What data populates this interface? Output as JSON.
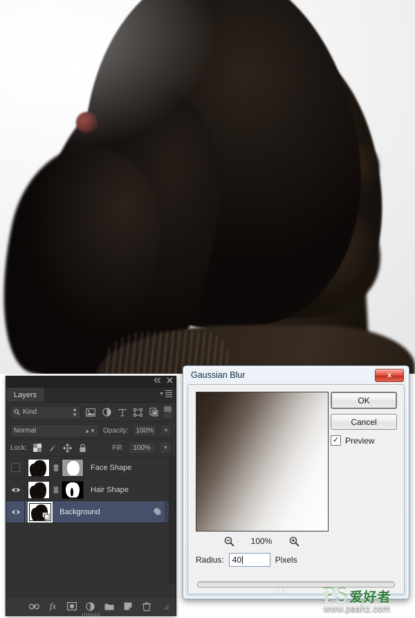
{
  "photo": {
    "description": "Dark silhouette portrait of a woman in profile with ponytail on white background",
    "subject_color": "#1b1510",
    "background_color": "#f4f4f4",
    "hair_tie_color": "#6b231f"
  },
  "layers_panel": {
    "titlebar": {
      "collapse_icon": "collapse-double-arrow-icon",
      "close_icon": "close-icon"
    },
    "tab_label": "Layers",
    "panel_menu_icon": "panel-menu-icon",
    "filter_row": {
      "kind_label": "Kind",
      "search_icon": "search-icon",
      "stepper_icon": "stepper-icon",
      "type_filters": [
        {
          "name": "filter-pixel-layers-icon",
          "glyph": "image"
        },
        {
          "name": "filter-adjustment-layers-icon",
          "glyph": "circle-half"
        },
        {
          "name": "filter-type-layers-icon",
          "glyph": "T"
        },
        {
          "name": "filter-shape-layers-icon",
          "glyph": "shape"
        },
        {
          "name": "filter-smart-objects-icon",
          "glyph": "smart-object"
        }
      ],
      "filter_toggle": "filter-enable-toggle"
    },
    "blend_row": {
      "blend_mode": "Normal",
      "opacity_label": "Opacity:",
      "opacity_value": "100%"
    },
    "lock_row": {
      "lock_label": "Lock:",
      "lock_icons": [
        "lock-transparent-pixels-icon",
        "lock-image-pixels-icon",
        "lock-position-icon",
        "lock-all-icon"
      ],
      "fill_label": "Fill:",
      "fill_value": "100%"
    },
    "layers": [
      {
        "name": "Face Shape",
        "visible": false,
        "selected": false,
        "linked": true,
        "has_mask": true,
        "mask_type": "gray",
        "has_effects": false
      },
      {
        "name": "Hair Shape",
        "visible": true,
        "selected": false,
        "linked": true,
        "has_mask": true,
        "mask_type": "black",
        "has_effects": false
      },
      {
        "name": "Background",
        "visible": true,
        "selected": true,
        "linked": false,
        "has_mask": false,
        "mask_type": "none",
        "has_effects": true,
        "effects_icon": "smart-filter-icon",
        "expand_icon": "chevron-down-icon"
      }
    ],
    "bottom_toolbar": [
      {
        "name": "link-layers-icon",
        "label": "Link layers"
      },
      {
        "name": "layer-style-fx-icon",
        "label": "fx"
      },
      {
        "name": "add-layer-mask-icon",
        "label": "Add layer mask"
      },
      {
        "name": "new-adjustment-layer-icon",
        "label": "New adjustment layer"
      },
      {
        "name": "new-group-icon",
        "label": "New group"
      },
      {
        "name": "new-layer-icon",
        "label": "New layer"
      },
      {
        "name": "delete-layer-icon",
        "label": "Delete layer"
      }
    ],
    "colors": {
      "panel_bg": "#323232",
      "selected_row": "#46506b",
      "text": "#d2d2d2"
    }
  },
  "dialog": {
    "title": "Gaussian Blur",
    "close_label": "x",
    "buttons": {
      "ok": "OK",
      "cancel": "Cancel"
    },
    "preview_checkbox": {
      "label": "Preview",
      "checked": true,
      "check_glyph": "✓"
    },
    "zoom": {
      "zoom_out_icon": "zoom-out-icon",
      "zoom_in_icon": "zoom-in-icon",
      "level": "100%"
    },
    "radius": {
      "label": "Radius:",
      "value": "40",
      "units": "Pixels"
    },
    "slider": {
      "position_percent": 40
    }
  },
  "watermark": {
    "logo_text": "PS",
    "logo_cn": "爱好者",
    "url": "www.psahz.com"
  }
}
